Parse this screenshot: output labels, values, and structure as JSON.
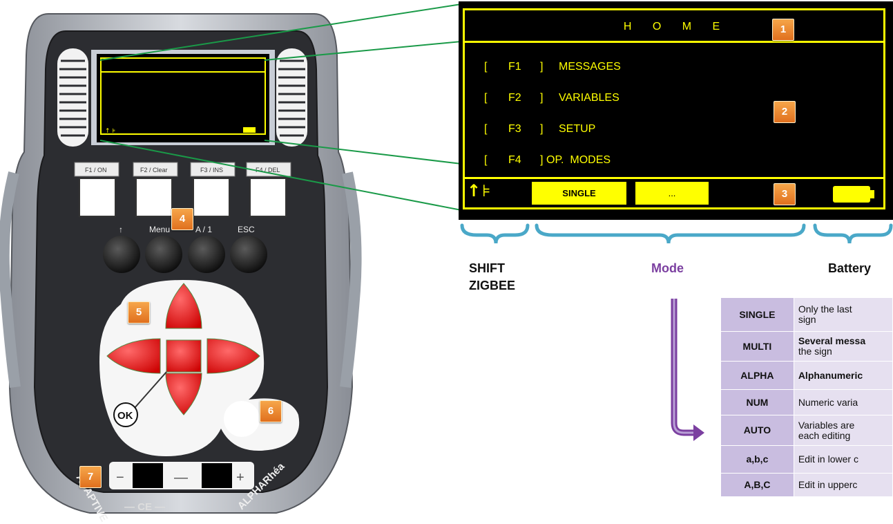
{
  "screen": {
    "title": "H O M E",
    "menu": [
      {
        "bracket": "[",
        "key": "F1",
        "close": "]",
        "label": "MESSAGES"
      },
      {
        "bracket": "[",
        "key": "F2",
        "close": "]",
        "label": "VARIABLES"
      },
      {
        "bracket": "[",
        "key": "F3",
        "close": "]",
        "label": "SETUP"
      },
      {
        "bracket": "[",
        "key": "F4",
        "close": "]",
        "label": "OP.  MODES"
      }
    ],
    "mode_primary": "SINGLE",
    "mode_secondary": "...",
    "shift_glyph": "↑",
    "zigbee_glyph": "⊧"
  },
  "badges": [
    "1",
    "2",
    "3",
    "4",
    "5",
    "6",
    "7"
  ],
  "captions": {
    "shift": "SHIFT",
    "zigbee": "ZIGBEE",
    "mode": "Mode",
    "battery": "Battery"
  },
  "device": {
    "f_keys": [
      "F1 / ON",
      "F2 / Clear",
      "F3 / INS",
      "F4 / DEL"
    ],
    "round_key_labels": [
      "↑",
      "Menu",
      "A / 1",
      "ESC"
    ],
    "ok_label": "OK",
    "minus": "−",
    "plus": "+",
    "brand_left": "ADAPTIVE",
    "brand_mid": "CE",
    "brand_right": "ALPHARhéa"
  },
  "mode_table": [
    {
      "key": "SINGLE",
      "desc": "Only the last",
      "desc2": "sign"
    },
    {
      "key": "MULTI",
      "desc": "Several messa",
      "desc2": "the sign"
    },
    {
      "key": "ALPHA",
      "desc": "Alphanumeric",
      "desc2": ""
    },
    {
      "key": "NUM",
      "desc": "Numeric varia",
      "desc2": ""
    },
    {
      "key": "AUTO",
      "desc": "Variables are",
      "desc2": "each editing"
    },
    {
      "key": "a,b,c",
      "desc": "Edit in lower c",
      "desc2": ""
    },
    {
      "key": "A,B,C",
      "desc": "Edit in upperc",
      "desc2": ""
    }
  ],
  "colors": {
    "screen_fg": "#ffff00",
    "mode_caption": "#7b3fa0",
    "brace": "#4aa8c8",
    "connector": "#1a9a48",
    "arrow": "#7b3fa0"
  }
}
